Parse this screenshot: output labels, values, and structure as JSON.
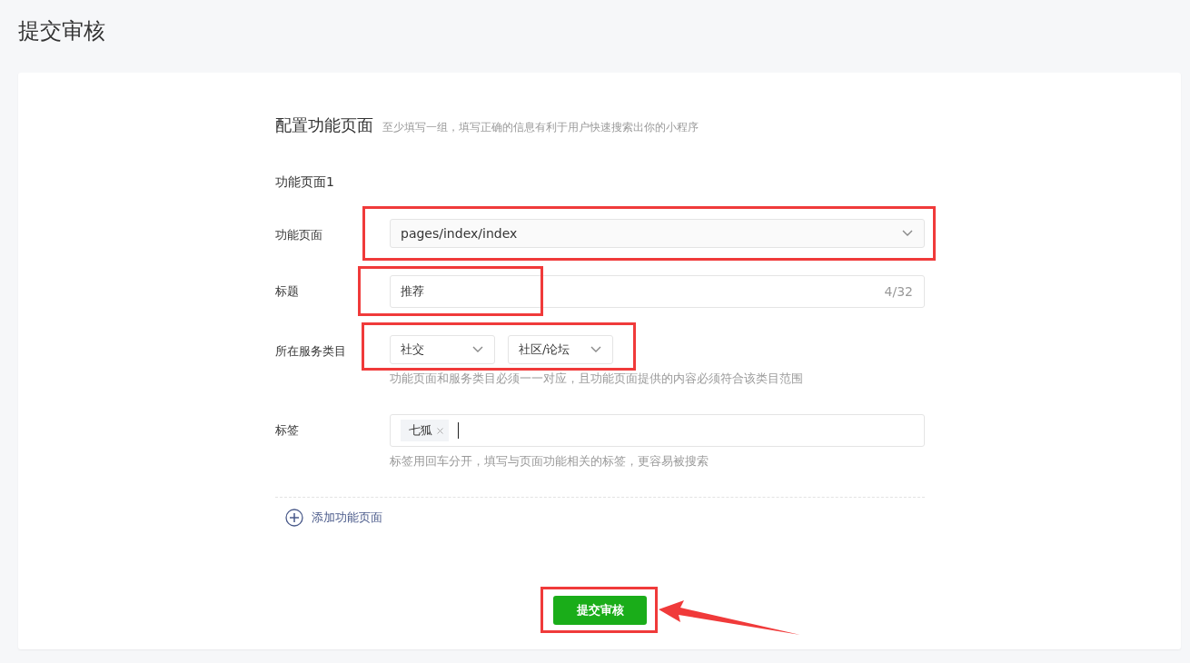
{
  "page_title": "提交审核",
  "section": {
    "title": "配置功能页面",
    "hint": "至少填写一组，填写正确的信息有利于用户快速搜索出你的小程序"
  },
  "group_title": "功能页面1",
  "fields": [
    {
      "kind": "select",
      "label": "功能页面",
      "value": "pages/index/index"
    },
    {
      "kind": "text",
      "label": "标题",
      "value": "推荐",
      "counter": "4/32"
    },
    {
      "kind": "selects",
      "label": "所在服务类目",
      "values": [
        "社交",
        "社区/论坛"
      ],
      "hint": "功能页面和服务类目必须一一对应，且功能页面提供的内容必须符合该类目范围"
    },
    {
      "kind": "tags",
      "label": "标签",
      "tags": [
        "七狐"
      ],
      "hint": "标签用回车分开，填写与页面功能相关的标签，更容易被搜索"
    }
  ],
  "add_link": "添加功能页面",
  "submit_button": "提交审核"
}
